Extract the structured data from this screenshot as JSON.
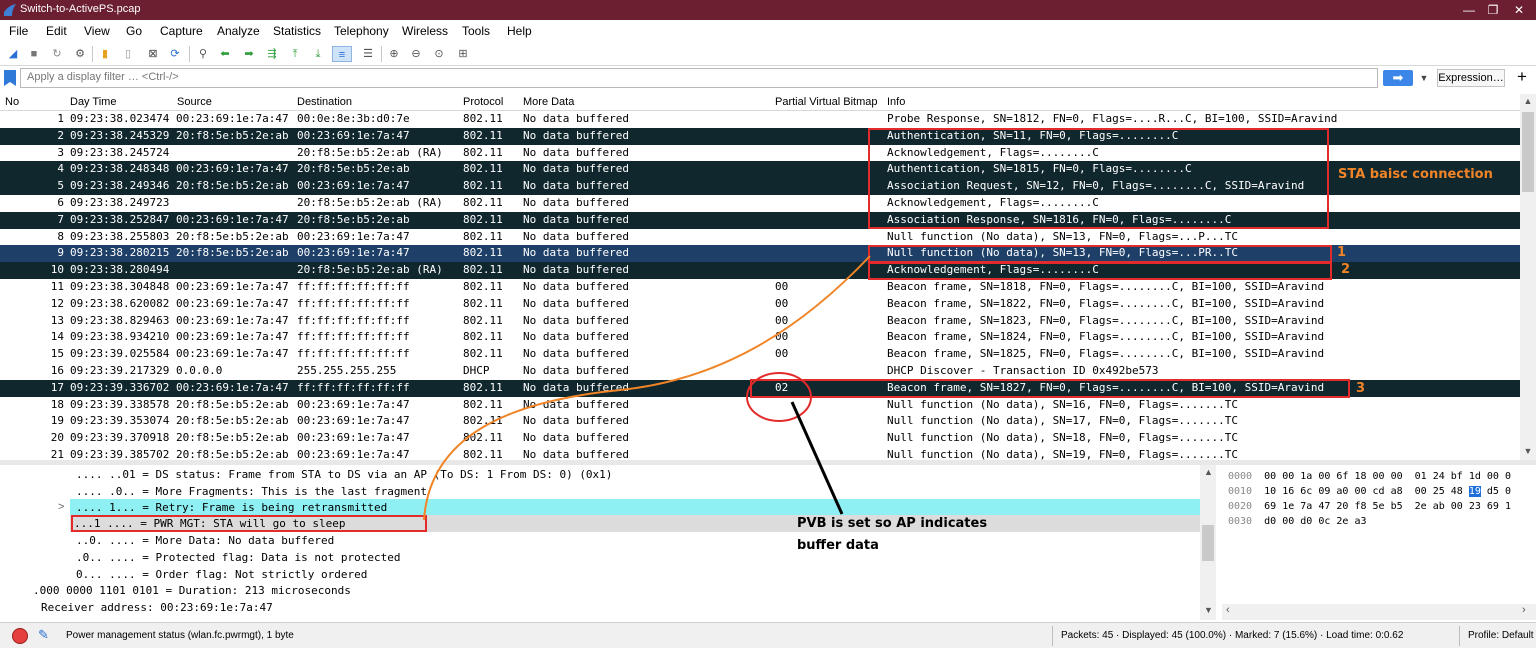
{
  "window": {
    "title": "Switch-to-ActivePS.pcap",
    "minimize": "—",
    "maximize": "❐",
    "close": "✕"
  },
  "menu": [
    "File",
    "Edit",
    "View",
    "Go",
    "Capture",
    "Analyze",
    "Statistics",
    "Telephony",
    "Wireless",
    "Tools",
    "Help"
  ],
  "filter": {
    "placeholder": "Apply a display filter … <Ctrl-/>",
    "expression_label": "Expression…",
    "plus_label": "+"
  },
  "columns": {
    "no": "No",
    "time": "Day Time",
    "source": "Source",
    "destination": "Destination",
    "protocol": "Protocol",
    "more_data": "More Data",
    "pvb": "Partial Virtual Bitmap",
    "info": "Info"
  },
  "packets": [
    {
      "no": "1",
      "time": "09:23:38.023474",
      "src": "00:23:69:1e:7a:47",
      "dst": "00:0e:8e:3b:d0:7e",
      "proto": "802.11",
      "more": "No data buffered",
      "pvb": "",
      "info": "Probe Response, SN=1812, FN=0, Flags=....R...C, BI=100, SSID=Aravind",
      "style": "light"
    },
    {
      "no": "2",
      "time": "09:23:38.245329",
      "src": "20:f8:5e:b5:2e:ab",
      "dst": "00:23:69:1e:7a:47",
      "proto": "802.11",
      "more": "No data buffered",
      "pvb": "",
      "info": "Authentication, SN=11, FN=0, Flags=........C",
      "style": "dark"
    },
    {
      "no": "3",
      "time": "09:23:38.245724",
      "src": "",
      "dst": "20:f8:5e:b5:2e:ab (RA)",
      "proto": "802.11",
      "more": "No data buffered",
      "pvb": "",
      "info": "Acknowledgement, Flags=........C",
      "style": "light"
    },
    {
      "no": "4",
      "time": "09:23:38.248348",
      "src": "00:23:69:1e:7a:47",
      "dst": "20:f8:5e:b5:2e:ab",
      "proto": "802.11",
      "more": "No data buffered",
      "pvb": "",
      "info": "Authentication, SN=1815, FN=0, Flags=........C",
      "style": "dark"
    },
    {
      "no": "5",
      "time": "09:23:38.249346",
      "src": "20:f8:5e:b5:2e:ab",
      "dst": "00:23:69:1e:7a:47",
      "proto": "802.11",
      "more": "No data buffered",
      "pvb": "",
      "info": "Association Request, SN=12, FN=0, Flags=........C, SSID=Aravind",
      "style": "dark"
    },
    {
      "no": "6",
      "time": "09:23:38.249723",
      "src": "",
      "dst": "20:f8:5e:b5:2e:ab (RA)",
      "proto": "802.11",
      "more": "No data buffered",
      "pvb": "",
      "info": "Acknowledgement, Flags=........C",
      "style": "light"
    },
    {
      "no": "7",
      "time": "09:23:38.252847",
      "src": "00:23:69:1e:7a:47",
      "dst": "20:f8:5e:b5:2e:ab",
      "proto": "802.11",
      "more": "No data buffered",
      "pvb": "",
      "info": "Association Response, SN=1816, FN=0, Flags=........C",
      "style": "dark"
    },
    {
      "no": "8",
      "time": "09:23:38.255803",
      "src": "20:f8:5e:b5:2e:ab",
      "dst": "00:23:69:1e:7a:47",
      "proto": "802.11",
      "more": "No data buffered",
      "pvb": "",
      "info": "Null function (No data), SN=13, FN=0, Flags=...P...TC",
      "style": "light"
    },
    {
      "no": "9",
      "time": "09:23:38.280215",
      "src": "20:f8:5e:b5:2e:ab",
      "dst": "00:23:69:1e:7a:47",
      "proto": "802.11",
      "more": "No data buffered",
      "pvb": "",
      "info": "Null function (No data), SN=13, FN=0, Flags=...PR..TC",
      "style": "sel"
    },
    {
      "no": "10",
      "time": "09:23:38.280494",
      "src": "",
      "dst": "20:f8:5e:b5:2e:ab (RA)",
      "proto": "802.11",
      "more": "No data buffered",
      "pvb": "",
      "info": "Acknowledgement, Flags=........C",
      "style": "dark"
    },
    {
      "no": "11",
      "time": "09:23:38.304848",
      "src": "00:23:69:1e:7a:47",
      "dst": "ff:ff:ff:ff:ff:ff",
      "proto": "802.11",
      "more": "No data buffered",
      "pvb": "00",
      "info": "Beacon frame, SN=1818, FN=0, Flags=........C, BI=100, SSID=Aravind",
      "style": "light"
    },
    {
      "no": "12",
      "time": "09:23:38.620082",
      "src": "00:23:69:1e:7a:47",
      "dst": "ff:ff:ff:ff:ff:ff",
      "proto": "802.11",
      "more": "No data buffered",
      "pvb": "00",
      "info": "Beacon frame, SN=1822, FN=0, Flags=........C, BI=100, SSID=Aravind",
      "style": "light"
    },
    {
      "no": "13",
      "time": "09:23:38.829463",
      "src": "00:23:69:1e:7a:47",
      "dst": "ff:ff:ff:ff:ff:ff",
      "proto": "802.11",
      "more": "No data buffered",
      "pvb": "00",
      "info": "Beacon frame, SN=1823, FN=0, Flags=........C, BI=100, SSID=Aravind",
      "style": "light"
    },
    {
      "no": "14",
      "time": "09:23:38.934210",
      "src": "00:23:69:1e:7a:47",
      "dst": "ff:ff:ff:ff:ff:ff",
      "proto": "802.11",
      "more": "No data buffered",
      "pvb": "00",
      "info": "Beacon frame, SN=1824, FN=0, Flags=........C, BI=100, SSID=Aravind",
      "style": "light"
    },
    {
      "no": "15",
      "time": "09:23:39.025584",
      "src": "00:23:69:1e:7a:47",
      "dst": "ff:ff:ff:ff:ff:ff",
      "proto": "802.11",
      "more": "No data buffered",
      "pvb": "00",
      "info": "Beacon frame, SN=1825, FN=0, Flags=........C, BI=100, SSID=Aravind",
      "style": "light"
    },
    {
      "no": "16",
      "time": "09:23:39.217329",
      "src": "0.0.0.0",
      "dst": "255.255.255.255",
      "proto": "DHCP",
      "more": "No data buffered",
      "pvb": "",
      "info": "DHCP Discover - Transaction ID 0x492be573",
      "style": "light"
    },
    {
      "no": "17",
      "time": "09:23:39.336702",
      "src": "00:23:69:1e:7a:47",
      "dst": "ff:ff:ff:ff:ff:ff",
      "proto": "802.11",
      "more": "No data buffered",
      "pvb": "02",
      "info": "Beacon frame, SN=1827, FN=0, Flags=........C, BI=100, SSID=Aravind",
      "style": "dark"
    },
    {
      "no": "18",
      "time": "09:23:39.338578",
      "src": "20:f8:5e:b5:2e:ab",
      "dst": "00:23:69:1e:7a:47",
      "proto": "802.11",
      "more": "No data buffered",
      "pvb": "",
      "info": "Null function (No data), SN=16, FN=0, Flags=.......TC",
      "style": "light"
    },
    {
      "no": "19",
      "time": "09:23:39.353074",
      "src": "20:f8:5e:b5:2e:ab",
      "dst": "00:23:69:1e:7a:47",
      "proto": "802.11",
      "more": "No data buffered",
      "pvb": "",
      "info": "Null function (No data), SN=17, FN=0, Flags=.......TC",
      "style": "light"
    },
    {
      "no": "20",
      "time": "09:23:39.370918",
      "src": "20:f8:5e:b5:2e:ab",
      "dst": "00:23:69:1e:7a:47",
      "proto": "802.11",
      "more": "No data buffered",
      "pvb": "",
      "info": "Null function (No data), SN=18, FN=0, Flags=.......TC",
      "style": "light"
    },
    {
      "no": "21",
      "time": "09:23:39.385702",
      "src": "20:f8:5e:b5:2e:ab",
      "dst": "00:23:69:1e:7a:47",
      "proto": "802.11",
      "more": "No data buffered",
      "pvb": "",
      "info": "Null function (No data), SN=19, FN=0, Flags=.......TC",
      "style": "light"
    }
  ],
  "details": [
    {
      "text": ".... ..01 = DS status: Frame from STA to DS via an AP (To DS: 1 From DS: 0) (0x1)",
      "hl": ""
    },
    {
      "text": ".... .0.. = More Fragments: This is the last fragment",
      "hl": ""
    },
    {
      "text": ".... 1... = Retry: Frame is being retransmitted",
      "hl": "cyan",
      "expander": ">"
    },
    {
      "text": "...1 .... = PWR MGT: STA will go to sleep",
      "hl": "grey"
    },
    {
      "text": "..0. .... = More Data: No data buffered",
      "hl": ""
    },
    {
      "text": ".0.. .... = Protected flag: Data is not protected",
      "hl": ""
    },
    {
      "text": "0... .... = Order flag: Not strictly ordered",
      "hl": ""
    },
    {
      "text": ".000 0000 1101 0101 = Duration: 213 microseconds",
      "hl": ""
    },
    {
      "text": "Receiver address: 00:23:69:1e:7a:47",
      "hl": ""
    }
  ],
  "bytes": [
    {
      "offset": "0000",
      "hex": "00 00 1a 00 6f 18 00 00  01 24 bf 1d 00 0"
    },
    {
      "offset": "0010",
      "hex_before": "10 16 6c 09 a0 00 cd a8  00 25 48 ",
      "hex_hi": "19",
      "hex_after": " d5 0"
    },
    {
      "offset": "0020",
      "hex": "69 1e 7a 47 20 f8 5e b5  2e ab 00 23 69 1"
    },
    {
      "offset": "0030",
      "hex": "d0 00 d0 0c 2e a3"
    }
  ],
  "status": {
    "field": "Power management status (wlan.fc.pwrmgt), 1 byte",
    "packets": "Packets: 45 · Displayed: 45 (100.0%) · Marked: 7 (15.6%) · Load time: 0:0.62",
    "profile": "Profile: Default"
  },
  "annotations": {
    "sta_connection": "STA baisc connection",
    "marker1": "1",
    "marker2": "2",
    "marker3": "3",
    "pvb_note_line1": "PVB is set so AP indicates",
    "pvb_note_line2": "buffer data",
    "red": "#e32b2b",
    "orange": "#f08427"
  },
  "colors": {
    "title_bg": "#6b1f30",
    "row_dark": "#10272e",
    "row_selected": "#1d3f68",
    "retry_highlight": "#8ff0f3"
  }
}
